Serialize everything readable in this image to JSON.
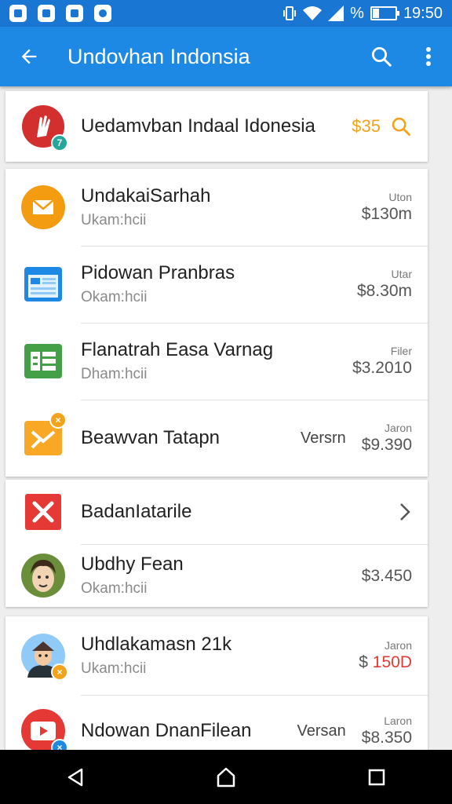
{
  "status_bar": {
    "battery": "%",
    "time": "19:50"
  },
  "app_bar": {
    "title": "Undovhan Indonsia"
  },
  "header_card": {
    "name": "Uedamvban Indaal Idonesia",
    "price": "$35"
  },
  "list1": [
    {
      "name": "UndakaiSarhah",
      "sub": "Ukam:hcii",
      "label": "Uton",
      "price": "$130m"
    },
    {
      "name": "Pidowan Pranbras",
      "sub": "Okam:hcii",
      "label": "Utar",
      "price": "$8.30m"
    },
    {
      "name": "Flanatrah Easa  Varnag",
      "sub": "Dham:hcii",
      "label": "Filer",
      "price": "$3.2010"
    },
    {
      "name": "Beawvan Tatapn",
      "mid": "Versrn",
      "label": "Jaron",
      "price": "$9.390"
    }
  ],
  "list2": [
    {
      "name": "BadanIatarile"
    },
    {
      "name": "Ubdhy Fean",
      "sub": "Okam:hcii",
      "price": "$3.450"
    }
  ],
  "list3": [
    {
      "name": "Uhdlakamasn 21k",
      "sub": "Ukam:hcii",
      "label": "Jaron",
      "price_sym": "$",
      "price_val": "150D"
    },
    {
      "name": "Ndowan DnanFilean",
      "mid": "Versan",
      "label": "Laron",
      "price": "$8.350"
    }
  ],
  "colors": {
    "status_bar": "#1976d2",
    "app_bar": "#1e88e5",
    "accent_orange": "#f2a31b",
    "price_red": "#e53935"
  },
  "icons": {
    "status_bar": [
      "notification-icon",
      "vibrate-icon",
      "wifi-icon",
      "signal-icon",
      "battery-icon"
    ],
    "app_bar": [
      "back-arrow-icon",
      "search-icon",
      "more-vert-icon"
    ],
    "nav": [
      "back-triangle-icon",
      "home-icon",
      "recents-icon"
    ]
  }
}
